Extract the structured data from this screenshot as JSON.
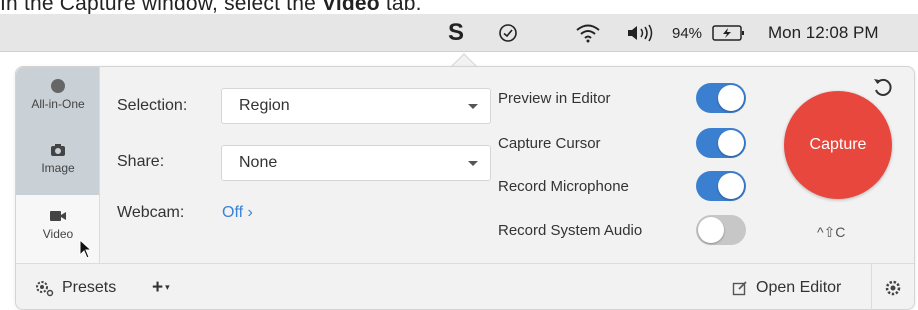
{
  "instruction": {
    "prefix": "In the Capture window, select the ",
    "target": "Video",
    "suffix": " tab."
  },
  "menubar": {
    "snagit_icon": "S",
    "battery_percent": "94%",
    "clock": "Mon 12:08 PM",
    "icons": [
      "snagit-icon",
      "check-circle-icon",
      "wifi-icon",
      "volume-icon",
      "battery-charging-icon"
    ]
  },
  "mode_tabs": [
    {
      "label": "All-in-One",
      "icon": "record-dot-icon",
      "selected": true
    },
    {
      "label": "Image",
      "icon": "camera-icon",
      "selected": true
    },
    {
      "label": "Video",
      "icon": "video-camera-icon",
      "selected": false
    }
  ],
  "settings": {
    "selection": {
      "label": "Selection:",
      "value": "Region"
    },
    "share": {
      "label": "Share:",
      "value": "None"
    },
    "webcam": {
      "label": "Webcam:",
      "value": "Off",
      "arrow": "›"
    }
  },
  "toggles": [
    {
      "label": "Preview in Editor",
      "on": true
    },
    {
      "label": "Capture Cursor",
      "on": true
    },
    {
      "label": "Record Microphone",
      "on": true
    },
    {
      "label": "Record System Audio",
      "on": false
    }
  ],
  "capture": {
    "label": "Capture",
    "shortcut": "^⇧C",
    "color": "#e8473d"
  },
  "footer": {
    "presets_label": "Presets",
    "add_label": "+",
    "open_editor_label": "Open Editor"
  },
  "colors": {
    "accent": "#3b7fd0",
    "link": "#3b82d6",
    "tab_selected_bg": "#c9d0d6"
  }
}
